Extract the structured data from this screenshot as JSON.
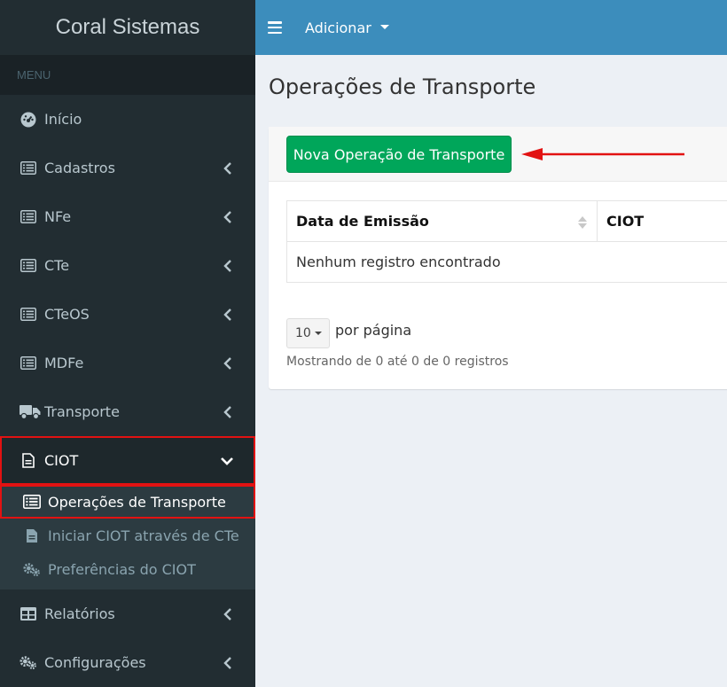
{
  "brand": "Coral Sistemas",
  "menu_header": "MENU",
  "sidebar": {
    "items": [
      {
        "label": "Início",
        "icon": "dashboard-icon"
      },
      {
        "label": "Cadastros",
        "icon": "list-icon"
      },
      {
        "label": "NFe",
        "icon": "list-icon"
      },
      {
        "label": "CTe",
        "icon": "list-icon"
      },
      {
        "label": "CTeOS",
        "icon": "list-icon"
      },
      {
        "label": "MDFe",
        "icon": "list-icon"
      },
      {
        "label": "Transporte",
        "icon": "truck-icon"
      },
      {
        "label": "CIOT",
        "icon": "file-icon"
      },
      {
        "label": "Relatórios",
        "icon": "table-icon"
      },
      {
        "label": "Configurações",
        "icon": "gears-icon"
      }
    ],
    "ciot_sub": [
      {
        "label": "Operações de Transporte",
        "icon": "list-icon"
      },
      {
        "label": "Iniciar CIOT através de CTe",
        "icon": "file-icon"
      },
      {
        "label": "Preferências do CIOT",
        "icon": "gears-icon"
      }
    ]
  },
  "topbar": {
    "add_label": "Adicionar"
  },
  "page": {
    "title": "Operações de Transporte",
    "new_button": "Nova Operação de Transporte",
    "table": {
      "headers": [
        "Data de Emissão",
        "CIOT"
      ],
      "empty": "Nenhum registro encontrado"
    },
    "page_size": "10",
    "per_page": "por página",
    "showing": "Mostrando de 0 até 0 de 0 registros"
  },
  "colors": {
    "sidebar": "#222d32",
    "topbar": "#3c8dbc",
    "success": "#00a65a",
    "highlight": "#e21212"
  }
}
